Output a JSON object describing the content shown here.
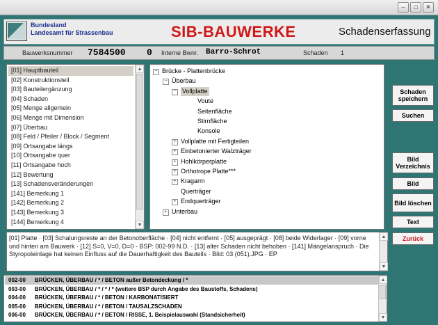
{
  "window": {
    "minimize_glyph": "–",
    "maximize_glyph": "□",
    "close_glyph": "✕"
  },
  "header": {
    "state": "Bundesland",
    "agency": "Landesamt für Strassenbau",
    "app_title": "SIB-BAUWERKE",
    "subtitle": "Schadenserfassung"
  },
  "info": {
    "bauwerksnummer_label": "Bauwerksnummer",
    "bauwerksnummer": "7584500",
    "teil": "0",
    "interne_label": "Interne Bwnr.",
    "interne": "Barro-Schrot",
    "schaden_label": "Schaden",
    "schaden": "1"
  },
  "categories": [
    "[01] Hauptbauteil",
    "[02] Konstruktionsteil",
    "[03] Bauteilergänzung",
    "[04] Schaden",
    "[05] Menge allgemein",
    "[06] Menge mit Dimension",
    "[07] Überbau",
    "[08] Feld / Pfeiler / Block / Segment",
    "[09] Ortsangabe längs",
    "[10] Ortsangabe quer",
    "[11] Ortsangabe hoch",
    "[12] Bewertung",
    "[13] Schadensveränderungen",
    "[141] Bemerkung 1",
    "[142] Bemerkung 2",
    "[143] Bemerkung 3",
    "[144] Bemerkung 4"
  ],
  "tree": [
    {
      "label": "Brücke - Plattenbrücke",
      "level": 0,
      "exp": "−"
    },
    {
      "label": "Überbau",
      "level": 1,
      "exp": "−"
    },
    {
      "label": "Vollplatte",
      "level": 2,
      "exp": "−",
      "selected": true
    },
    {
      "label": "Voute",
      "level": 3,
      "exp": ""
    },
    {
      "label": "Seitenfläche",
      "level": 3,
      "exp": ""
    },
    {
      "label": "Stirnfläche",
      "level": 3,
      "exp": ""
    },
    {
      "label": "Konsole",
      "level": 3,
      "exp": ""
    },
    {
      "label": "Vollplatte mit Fertigteilen",
      "level": 2,
      "exp": "+"
    },
    {
      "label": "Einbetonierter Walzträger",
      "level": 2,
      "exp": "+"
    },
    {
      "label": "Hohlkörperplatte",
      "level": 2,
      "exp": "+"
    },
    {
      "label": "Orthotrope Platte***",
      "level": 2,
      "exp": "+"
    },
    {
      "label": "Kragarm",
      "level": 2,
      "exp": "+"
    },
    {
      "label": "Querträger",
      "level": 2,
      "exp": ""
    },
    {
      "label": "Endquerträger",
      "level": 2,
      "exp": "+"
    },
    {
      "label": "Unterbau",
      "level": 1,
      "exp": "+"
    }
  ],
  "buttons": {
    "save": "Schaden speichern",
    "search": "Suchen",
    "img_dir": "Bild Verzeichnis",
    "img": "Bild",
    "img_del": "Bild löschen",
    "text": "Text",
    "back": "Zurück"
  },
  "description": "[01] Platte · [03] Schalungsreste an der Betonoberfläche · [04] nicht entfernt · [05] ausgeprägt · [08] beide Widerlager · [09] vorne und hinten am Bauwerk · [12] S=0, V=0, D=0 - BSP: 002-99 N.D. · [13] alter Schaden nicht behoben · [141] Mängelanspruch · Die Styropoleinlage hat keinen Einfluss auf die Dauerhaftigkeit des Bauteils · Bild: 03 (051).JPG · EP",
  "list": [
    {
      "code": "002-00",
      "text": "BRÜCKEN, ÜBERBAU / * / BETON außer Betondeckung / *"
    },
    {
      "code": "003-00",
      "text": "BRÜCKEN, ÜBERBAU / * / * / * (weitere BSP durch Angabe des Baustoffs, Schadens)"
    },
    {
      "code": "004-00",
      "text": "BRÜCKEN, ÜBERBAU / * / BETON / KARBONATISIERT"
    },
    {
      "code": "005-00",
      "text": "BRÜCKEN, ÜBERBAU / * / BETON / TAUSALZSCHADEN"
    },
    {
      "code": "006-00",
      "text": "BRÜCKEN, ÜBERBAU / * / BETON / RISSE, 1. Beispielauswahl (Standsicherheit)"
    }
  ],
  "colors": {
    "frame": "#2f7574",
    "title_red": "#d11818",
    "agency_blue": "#1c2f8f"
  }
}
